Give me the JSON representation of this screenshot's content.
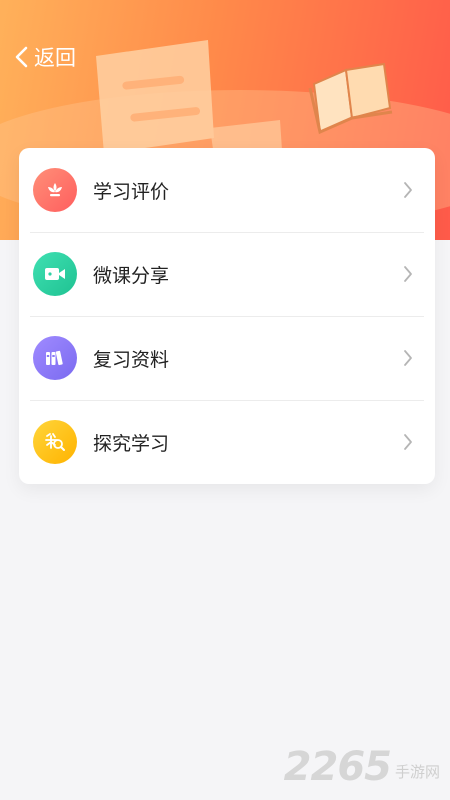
{
  "header": {
    "back_label": "返回"
  },
  "menu": {
    "items": [
      {
        "label": "学习评价",
        "icon": "flower-icon",
        "color": "#ff7868"
      },
      {
        "label": "微课分享",
        "icon": "video-camera-icon",
        "color": "#2fd1a4"
      },
      {
        "label": "复习资料",
        "icon": "books-icon",
        "color": "#8b7cf6"
      },
      {
        "label": "探究学习",
        "icon": "magnifier-icon",
        "color": "#ffc31a"
      }
    ]
  },
  "watermark": {
    "number": "2265",
    "text": "手游网"
  }
}
